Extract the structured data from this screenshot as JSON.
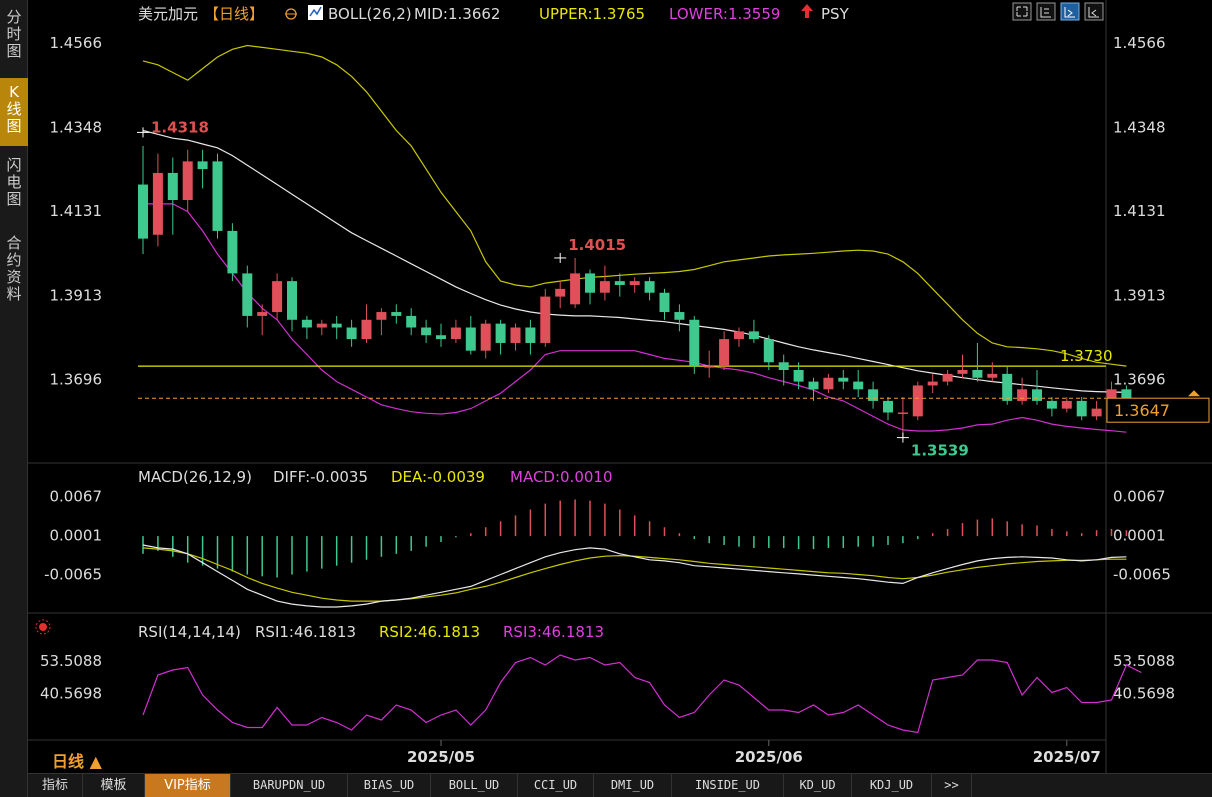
{
  "sidebar": {
    "items": [
      {
        "label": "分时图",
        "active": false
      },
      {
        "label": "K线图",
        "active": true
      },
      {
        "label": "闪电图",
        "active": false
      },
      {
        "label": "合约资料",
        "active": false
      }
    ]
  },
  "header": {
    "symbol": "美元加元",
    "period_tag": "【日线】",
    "boll_text": "BOLL(26,2)",
    "mid_text": "MID:1.3662",
    "upper_text": "UPPER:1.3765",
    "lower_text": "LOWER:1.3559",
    "psy_text": "PSY"
  },
  "macd_header": {
    "name": "MACD(26,12,9)",
    "diff_text": "DIFF:-0.0035",
    "dea_text": "DEA:-0.0039",
    "macd_text": "MACD:0.0010"
  },
  "rsi_header": {
    "name": "RSI(14,14,14)",
    "rsi1_text": "RSI1:46.1813",
    "rsi2_text": "RSI2:46.1813",
    "rsi3_text": "RSI3:46.1813"
  },
  "period_label": "日线 ▲",
  "bottom_tabs": [
    "指标",
    "模板",
    "VIP指标",
    "BARUPDN_UD",
    "BIAS_UD",
    "BOLL_UD",
    "CCI_UD",
    "DMI_UD",
    "INSIDE_UD",
    "KD_UD",
    "KDJ_UD",
    ">>"
  ],
  "chart_data": {
    "type": "candlestick",
    "price_axis_labels": [
      "1.4566",
      "1.4348",
      "1.4131",
      "1.3913",
      "1.3696"
    ],
    "price_ylim": [
      1.35,
      1.46
    ],
    "macd_axis_labels": [
      "0.0067",
      "0.0001",
      "-0.0065"
    ],
    "macd_ylim": [
      -0.0125,
      0.0078
    ],
    "rsi_axis_labels": [
      "53.5088",
      "40.5698"
    ],
    "rsi_ylim": [
      22,
      60
    ],
    "x_labels": [
      {
        "label": "2025/05",
        "index": 20
      },
      {
        "label": "2025/06",
        "index": 42
      },
      {
        "label": "2025/07",
        "index": 62
      }
    ],
    "high_annotation": {
      "label": "1.4318",
      "index": 0,
      "value": 1.4335
    },
    "mid_high_annotation": {
      "label": "1.4015",
      "index": 28,
      "value": 1.401
    },
    "low_annotation": {
      "label": "1.3539",
      "index": 51,
      "value": 1.3545
    },
    "level_line": {
      "value": 1.373,
      "label": "1.3730",
      "color": "#e8e800"
    },
    "current_price": {
      "value": 1.3647,
      "label": "1.3647",
      "color": "#f0a030"
    },
    "candles": [
      [
        1.42,
        1.406,
        1.43,
        1.402
      ],
      [
        1.407,
        1.423,
        1.428,
        1.404
      ],
      [
        1.423,
        1.416,
        1.427,
        1.407
      ],
      [
        1.416,
        1.426,
        1.429,
        1.413
      ],
      [
        1.426,
        1.424,
        1.429,
        1.419
      ],
      [
        1.426,
        1.408,
        1.428,
        1.406
      ],
      [
        1.408,
        1.397,
        1.41,
        1.395
      ],
      [
        1.397,
        1.386,
        1.399,
        1.383
      ],
      [
        1.386,
        1.387,
        1.389,
        1.381
      ],
      [
        1.387,
        1.395,
        1.397,
        1.385
      ],
      [
        1.395,
        1.385,
        1.396,
        1.382
      ],
      [
        1.385,
        1.383,
        1.386,
        1.38
      ],
      [
        1.383,
        1.384,
        1.385,
        1.381
      ],
      [
        1.384,
        1.383,
        1.386,
        1.38
      ],
      [
        1.383,
        1.38,
        1.385,
        1.378
      ],
      [
        1.38,
        1.385,
        1.389,
        1.379
      ],
      [
        1.385,
        1.387,
        1.388,
        1.381
      ],
      [
        1.387,
        1.386,
        1.389,
        1.384
      ],
      [
        1.386,
        1.383,
        1.388,
        1.381
      ],
      [
        1.383,
        1.381,
        1.385,
        1.379
      ],
      [
        1.381,
        1.38,
        1.384,
        1.378
      ],
      [
        1.38,
        1.383,
        1.385,
        1.379
      ],
      [
        1.383,
        1.377,
        1.386,
        1.376
      ],
      [
        1.377,
        1.384,
        1.385,
        1.375
      ],
      [
        1.384,
        1.379,
        1.385,
        1.376
      ],
      [
        1.379,
        1.383,
        1.384,
        1.377
      ],
      [
        1.383,
        1.379,
        1.385,
        1.376
      ],
      [
        1.379,
        1.391,
        1.393,
        1.378
      ],
      [
        1.391,
        1.393,
        1.395,
        1.388
      ],
      [
        1.389,
        1.397,
        1.401,
        1.388
      ],
      [
        1.397,
        1.392,
        1.398,
        1.389
      ],
      [
        1.392,
        1.395,
        1.399,
        1.39
      ],
      [
        1.395,
        1.394,
        1.397,
        1.391
      ],
      [
        1.394,
        1.395,
        1.396,
        1.392
      ],
      [
        1.395,
        1.392,
        1.396,
        1.39
      ],
      [
        1.392,
        1.387,
        1.393,
        1.385
      ],
      [
        1.387,
        1.385,
        1.389,
        1.382
      ],
      [
        1.385,
        1.373,
        1.386,
        1.371
      ],
      [
        1.373,
        1.373,
        1.377,
        1.37
      ],
      [
        1.373,
        1.38,
        1.382,
        1.372
      ],
      [
        1.38,
        1.382,
        1.383,
        1.378
      ],
      [
        1.382,
        1.38,
        1.385,
        1.379
      ],
      [
        1.38,
        1.374,
        1.381,
        1.372
      ],
      [
        1.374,
        1.372,
        1.376,
        1.368
      ],
      [
        1.372,
        1.369,
        1.374,
        1.367
      ],
      [
        1.369,
        1.367,
        1.37,
        1.364
      ],
      [
        1.367,
        1.37,
        1.371,
        1.366
      ],
      [
        1.37,
        1.369,
        1.372,
        1.367
      ],
      [
        1.369,
        1.367,
        1.372,
        1.365
      ],
      [
        1.367,
        1.364,
        1.369,
        1.362
      ],
      [
        1.364,
        1.361,
        1.365,
        1.359
      ],
      [
        1.361,
        1.361,
        1.365,
        1.354
      ],
      [
        1.36,
        1.368,
        1.369,
        1.359
      ],
      [
        1.368,
        1.369,
        1.371,
        1.366
      ],
      [
        1.369,
        1.371,
        1.372,
        1.368
      ],
      [
        1.371,
        1.372,
        1.376,
        1.37
      ],
      [
        1.372,
        1.37,
        1.379,
        1.369
      ],
      [
        1.37,
        1.371,
        1.374,
        1.369
      ],
      [
        1.371,
        1.364,
        1.373,
        1.363
      ],
      [
        1.364,
        1.367,
        1.37,
        1.363
      ],
      [
        1.367,
        1.364,
        1.372,
        1.363
      ],
      [
        1.364,
        1.362,
        1.365,
        1.36
      ],
      [
        1.362,
        1.364,
        1.365,
        1.361
      ],
      [
        1.364,
        1.36,
        1.365,
        1.359
      ],
      [
        1.36,
        1.362,
        1.364,
        1.359
      ],
      [
        1.362,
        1.367,
        1.369,
        1.361
      ],
      [
        1.367,
        1.3647,
        1.368,
        1.363
      ]
    ],
    "boll_mid": [
      1.434,
      1.433,
      1.432,
      1.4315,
      1.4305,
      1.4295,
      1.4275,
      1.425,
      1.4225,
      1.42,
      1.4175,
      1.415,
      1.4125,
      1.41,
      1.4075,
      1.4055,
      1.4035,
      1.4015,
      1.3995,
      1.3975,
      1.3955,
      1.3935,
      1.3918,
      1.3902,
      1.3888,
      1.3878,
      1.387,
      1.3865,
      1.3862,
      1.386,
      1.386,
      1.3858,
      1.3856,
      1.3852,
      1.3848,
      1.3845,
      1.384,
      1.3835,
      1.383,
      1.3825,
      1.3818,
      1.381,
      1.38,
      1.379,
      1.378,
      1.3772,
      1.3765,
      1.3758,
      1.375,
      1.3742,
      1.3734,
      1.3726,
      1.3718,
      1.3712,
      1.3706,
      1.37,
      1.3695,
      1.369,
      1.3686,
      1.3682,
      1.3678,
      1.3674,
      1.367,
      1.3666,
      1.3664,
      1.3663,
      1.3662
    ],
    "boll_upper": [
      1.452,
      1.451,
      1.449,
      1.447,
      1.45,
      1.453,
      1.455,
      1.456,
      1.4555,
      1.455,
      1.4545,
      1.454,
      1.453,
      1.451,
      1.448,
      1.444,
      1.439,
      1.434,
      1.43,
      1.424,
      1.418,
      1.413,
      1.408,
      1.4,
      1.395,
      1.394,
      1.3935,
      1.3945,
      1.395,
      1.3955,
      1.396,
      1.3962,
      1.3965,
      1.3968,
      1.397,
      1.3972,
      1.3975,
      1.398,
      1.399,
      1.4,
      1.4005,
      1.401,
      1.4015,
      1.4018,
      1.402,
      1.4022,
      1.4025,
      1.4028,
      1.403,
      1.4028,
      1.402,
      1.4,
      1.397,
      1.393,
      1.389,
      1.385,
      1.3815,
      1.379,
      1.378,
      1.3778,
      1.3775,
      1.377,
      1.3762,
      1.375,
      1.374,
      1.3735,
      1.373
    ],
    "boll_lower": [
      1.415,
      1.415,
      1.415,
      1.413,
      1.408,
      1.402,
      1.397,
      1.392,
      1.388,
      1.385,
      1.38,
      1.376,
      1.372,
      1.369,
      1.367,
      1.365,
      1.363,
      1.362,
      1.3612,
      1.3608,
      1.3606,
      1.361,
      1.362,
      1.364,
      1.366,
      1.369,
      1.372,
      1.376,
      1.377,
      1.377,
      1.377,
      1.377,
      1.377,
      1.377,
      1.376,
      1.375,
      1.3745,
      1.374,
      1.373,
      1.3725,
      1.372,
      1.3712,
      1.37,
      1.369,
      1.368,
      1.3668,
      1.365,
      1.364,
      1.362,
      1.36,
      1.358,
      1.3565,
      1.3562,
      1.3562,
      1.3565,
      1.357,
      1.3578,
      1.358,
      1.359,
      1.3597,
      1.359,
      1.358,
      1.3574,
      1.357,
      1.3566,
      1.3563,
      1.3559
    ],
    "macd_hist": [
      -0.003,
      -0.0025,
      -0.0035,
      -0.0045,
      -0.005,
      -0.0055,
      -0.006,
      -0.0065,
      -0.0068,
      -0.007,
      -0.0065,
      -0.006,
      -0.0055,
      -0.005,
      -0.0045,
      -0.004,
      -0.0035,
      -0.003,
      -0.0025,
      -0.0018,
      -0.001,
      -0.0002,
      0.0005,
      0.0015,
      0.0025,
      0.0035,
      0.0045,
      0.0055,
      0.006,
      0.0062,
      0.006,
      0.0055,
      0.0045,
      0.0035,
      0.0025,
      0.0015,
      0.0005,
      -0.0005,
      -0.0012,
      -0.0015,
      -0.0018,
      -0.002,
      -0.002,
      -0.002,
      -0.0022,
      -0.0022,
      -0.002,
      -0.002,
      -0.0018,
      -0.0018,
      -0.0015,
      -0.0012,
      -0.0005,
      0.0005,
      0.0012,
      0.0022,
      0.0028,
      0.003,
      0.0025,
      0.002,
      0.0018,
      0.0012,
      0.0008,
      0.0005,
      0.001,
      0.0012,
      0.001
    ],
    "macd_diff": [
      -0.0015,
      -0.002,
      -0.0022,
      -0.003,
      -0.0045,
      -0.006,
      -0.0075,
      -0.009,
      -0.01,
      -0.011,
      -0.0115,
      -0.0118,
      -0.012,
      -0.012,
      -0.0118,
      -0.0115,
      -0.011,
      -0.0108,
      -0.0105,
      -0.01,
      -0.0095,
      -0.009,
      -0.0085,
      -0.0075,
      -0.0065,
      -0.0055,
      -0.0045,
      -0.0035,
      -0.0028,
      -0.0023,
      -0.002,
      -0.0022,
      -0.003,
      -0.0035,
      -0.004,
      -0.0042,
      -0.0045,
      -0.005,
      -0.0052,
      -0.0054,
      -0.0056,
      -0.0058,
      -0.006,
      -0.0062,
      -0.0064,
      -0.0066,
      -0.0068,
      -0.007,
      -0.0072,
      -0.0075,
      -0.0078,
      -0.008,
      -0.007,
      -0.0062,
      -0.0055,
      -0.0048,
      -0.0042,
      -0.0038,
      -0.0036,
      -0.0035,
      -0.0036,
      -0.0037,
      -0.004,
      -0.0042,
      -0.004,
      -0.0036,
      -0.0035
    ],
    "macd_dea": [
      -0.002,
      -0.0022,
      -0.0025,
      -0.003,
      -0.0038,
      -0.0048,
      -0.0058,
      -0.007,
      -0.008,
      -0.0088,
      -0.0095,
      -0.01,
      -0.0105,
      -0.0108,
      -0.011,
      -0.011,
      -0.011,
      -0.0108,
      -0.0106,
      -0.0103,
      -0.01,
      -0.0096,
      -0.009,
      -0.0085,
      -0.0078,
      -0.007,
      -0.0062,
      -0.0055,
      -0.0048,
      -0.0042,
      -0.0037,
      -0.0034,
      -0.0033,
      -0.0034,
      -0.0036,
      -0.0038,
      -0.004,
      -0.0043,
      -0.0046,
      -0.0048,
      -0.005,
      -0.0052,
      -0.0054,
      -0.0056,
      -0.0058,
      -0.006,
      -0.0062,
      -0.0063,
      -0.0065,
      -0.0067,
      -0.007,
      -0.0072,
      -0.007,
      -0.0066,
      -0.0061,
      -0.0057,
      -0.0053,
      -0.005,
      -0.0047,
      -0.0045,
      -0.0043,
      -0.0042,
      -0.0041,
      -0.0041,
      -0.004,
      -0.0039,
      -0.0039
    ],
    "rsi": [
      32,
      48,
      50,
      51,
      40,
      34,
      29,
      27,
      27,
      35,
      28,
      28,
      31,
      29,
      26,
      32,
      30,
      36,
      34,
      29,
      32,
      34,
      28,
      34,
      45,
      53,
      55,
      52,
      56,
      54,
      55,
      52,
      53,
      47,
      45,
      36,
      31,
      33,
      40,
      46,
      44,
      39,
      34,
      34,
      33,
      36,
      32,
      33,
      36,
      32,
      28,
      26,
      25,
      46,
      47,
      48,
      54,
      54,
      53,
      40,
      47,
      41,
      43,
      37,
      37,
      38,
      52,
      49
    ]
  }
}
